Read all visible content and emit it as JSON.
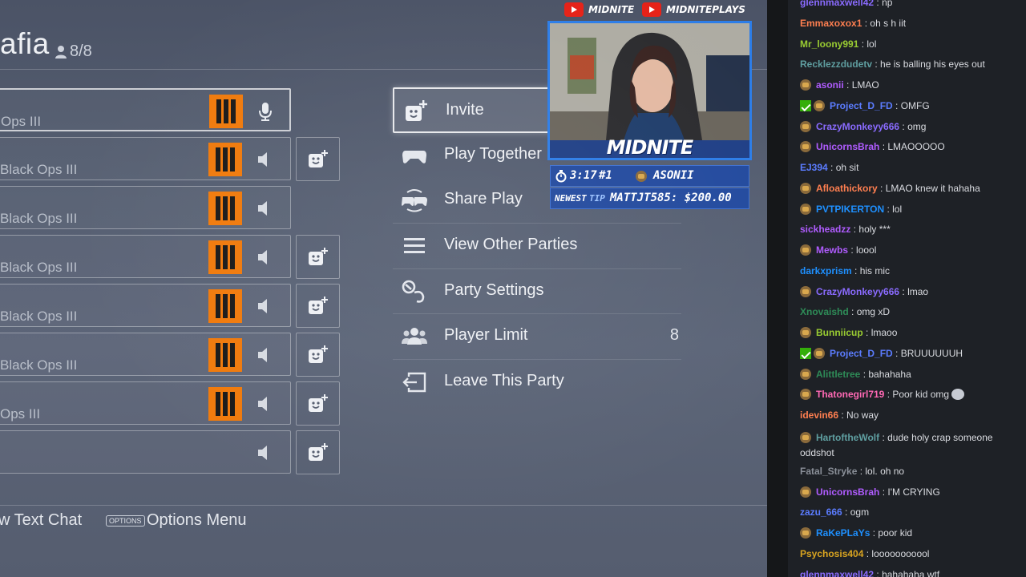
{
  "party": {
    "title": "afia",
    "count": "8/8",
    "members": [
      {
        "game": "Ops III",
        "has_logo": true,
        "audio": "mic",
        "add_friend": false,
        "active": true
      },
      {
        "game": "Black Ops III",
        "has_logo": true,
        "audio": "speaker",
        "add_friend": true,
        "active": false
      },
      {
        "game": "Black Ops III",
        "has_logo": true,
        "audio": "speaker",
        "add_friend": false,
        "active": false
      },
      {
        "game": "Black Ops III",
        "has_logo": true,
        "audio": "speaker",
        "add_friend": true,
        "active": false
      },
      {
        "game": "Black Ops III",
        "has_logo": true,
        "audio": "speaker",
        "add_friend": true,
        "active": false
      },
      {
        "game": "Black Ops III",
        "has_logo": true,
        "audio": "speaker",
        "add_friend": true,
        "active": false
      },
      {
        "game": "Ops III",
        "has_logo": true,
        "audio": "speaker",
        "add_friend": true,
        "active": false
      },
      {
        "game": "",
        "has_logo": false,
        "audio": "speaker",
        "add_friend": true,
        "active": false
      }
    ]
  },
  "menu": {
    "items": [
      {
        "label": "Invite",
        "icon": "invite-icon",
        "value": ""
      },
      {
        "label": "Play Together",
        "icon": "controller-icon",
        "value": ""
      },
      {
        "label": "Share Play",
        "icon": "share-play-icon",
        "value": ""
      },
      {
        "label": "View Other Parties",
        "icon": "list-icon",
        "value": ""
      },
      {
        "label": "Party Settings",
        "icon": "settings-icon",
        "value": ""
      },
      {
        "label": "Player Limit",
        "icon": "players-icon",
        "value": "8"
      },
      {
        "label": "Leave This Party",
        "icon": "leave-icon",
        "value": ""
      }
    ]
  },
  "footer": {
    "text_chat": "w Text Chat",
    "options_key": "OPTIONS",
    "options_menu": "Options Menu"
  },
  "overlay": {
    "social_1": "MIDNITE",
    "social_2": "MIDNITEPLAYS",
    "webcam_logo": "MIDNITE",
    "timer": "3:17",
    "rank": "#1",
    "top_user": "ASONII",
    "newest_label": "NEWEST",
    "tip_label": "TIP",
    "tip_value": "MATTJT585: $200.00",
    "brand_color": "#2c7de8",
    "youtube_color": "#e62117"
  },
  "chat": [
    {
      "user": "glennmaxwell42",
      "color": "#8a6bff",
      "msg": "np",
      "badges": []
    },
    {
      "user": "Emmaxoxox1",
      "color": "#ff7f50",
      "msg": "oh s h iit",
      "badges": []
    },
    {
      "user": "Mr_loony991",
      "color": "#9acd32",
      "msg": "lol",
      "badges": []
    },
    {
      "user": "Recklezzdudetv",
      "color": "#5f9ea0",
      "msg": "he is balling his eyes out",
      "badges": []
    },
    {
      "user": "asonii",
      "color": "#b05cff",
      "msg": "LMAO",
      "badges": [
        "sub"
      ]
    },
    {
      "user": "Project_D_FD",
      "color": "#5b7cff",
      "msg": "OMFG",
      "badges": [
        "mod",
        "sub"
      ]
    },
    {
      "user": "CrazyMonkeyy666",
      "color": "#8a6bff",
      "msg": "omg",
      "badges": [
        "sub"
      ]
    },
    {
      "user": "UnicornsBrah",
      "color": "#b05cff",
      "msg": "LMAOOOOO",
      "badges": [
        "sub"
      ]
    },
    {
      "user": "EJ394",
      "color": "#5b7cff",
      "msg": "oh sit",
      "badges": []
    },
    {
      "user": "Afloathickory",
      "color": "#ff7f50",
      "msg": "LMAO knew it hahaha",
      "badges": [
        "sub"
      ]
    },
    {
      "user": "PVTPIKERTON",
      "color": "#1e90ff",
      "msg": "lol",
      "badges": [
        "sub"
      ]
    },
    {
      "user": "sickheadzz",
      "color": "#b05cff",
      "msg": "holy ***",
      "badges": []
    },
    {
      "user": "Mewbs",
      "color": "#b05cff",
      "msg": "loool",
      "badges": [
        "sub"
      ]
    },
    {
      "user": "darkxprism",
      "color": "#1e90ff",
      "msg": "his mic",
      "badges": []
    },
    {
      "user": "CrazyMonkeyy666",
      "color": "#8a6bff",
      "msg": "lmao",
      "badges": [
        "sub"
      ]
    },
    {
      "user": "Xnovaishd",
      "color": "#2e8b57",
      "msg": "omg xD",
      "badges": []
    },
    {
      "user": "Bunniicup",
      "color": "#9acd32",
      "msg": "lmaoo",
      "badges": [
        "sub"
      ]
    },
    {
      "user": "Project_D_FD",
      "color": "#5b7cff",
      "msg": "BRUUUUUUH",
      "badges": [
        "mod",
        "sub"
      ]
    },
    {
      "user": "Alittletree",
      "color": "#2e8b57",
      "msg": "bahahaha",
      "badges": [
        "sub"
      ]
    },
    {
      "user": "Thatonegirl719",
      "color": "#ff69b4",
      "msg": "Poor kid omg",
      "badges": [
        "sub"
      ],
      "emote": true
    },
    {
      "user": "idevin66",
      "color": "#ff7f50",
      "msg": "No way",
      "badges": []
    },
    {
      "user": "HartoftheWolf",
      "color": "#5f9ea0",
      "msg": "dude holy crap someone oddshot",
      "badges": [
        "sub"
      ],
      "wrap": true
    },
    {
      "user": "Fatal_Stryke",
      "color": "#8a8f98",
      "msg": "lol. oh no",
      "badges": []
    },
    {
      "user": "UnicornsBrah",
      "color": "#b05cff",
      "msg": "I'M CRYING",
      "badges": [
        "sub"
      ]
    },
    {
      "user": "zazu_666",
      "color": "#5b7cff",
      "msg": "ogm",
      "badges": []
    },
    {
      "user": "RaKePLaYs",
      "color": "#1e90ff",
      "msg": "poor kid",
      "badges": [
        "sub"
      ]
    },
    {
      "user": "Psychosis404",
      "color": "#daa520",
      "msg": "looooooooool",
      "badges": []
    },
    {
      "user": "glennmaxwell42",
      "color": "#8a6bff",
      "msg": "hahahaha wtf",
      "badges": []
    }
  ]
}
